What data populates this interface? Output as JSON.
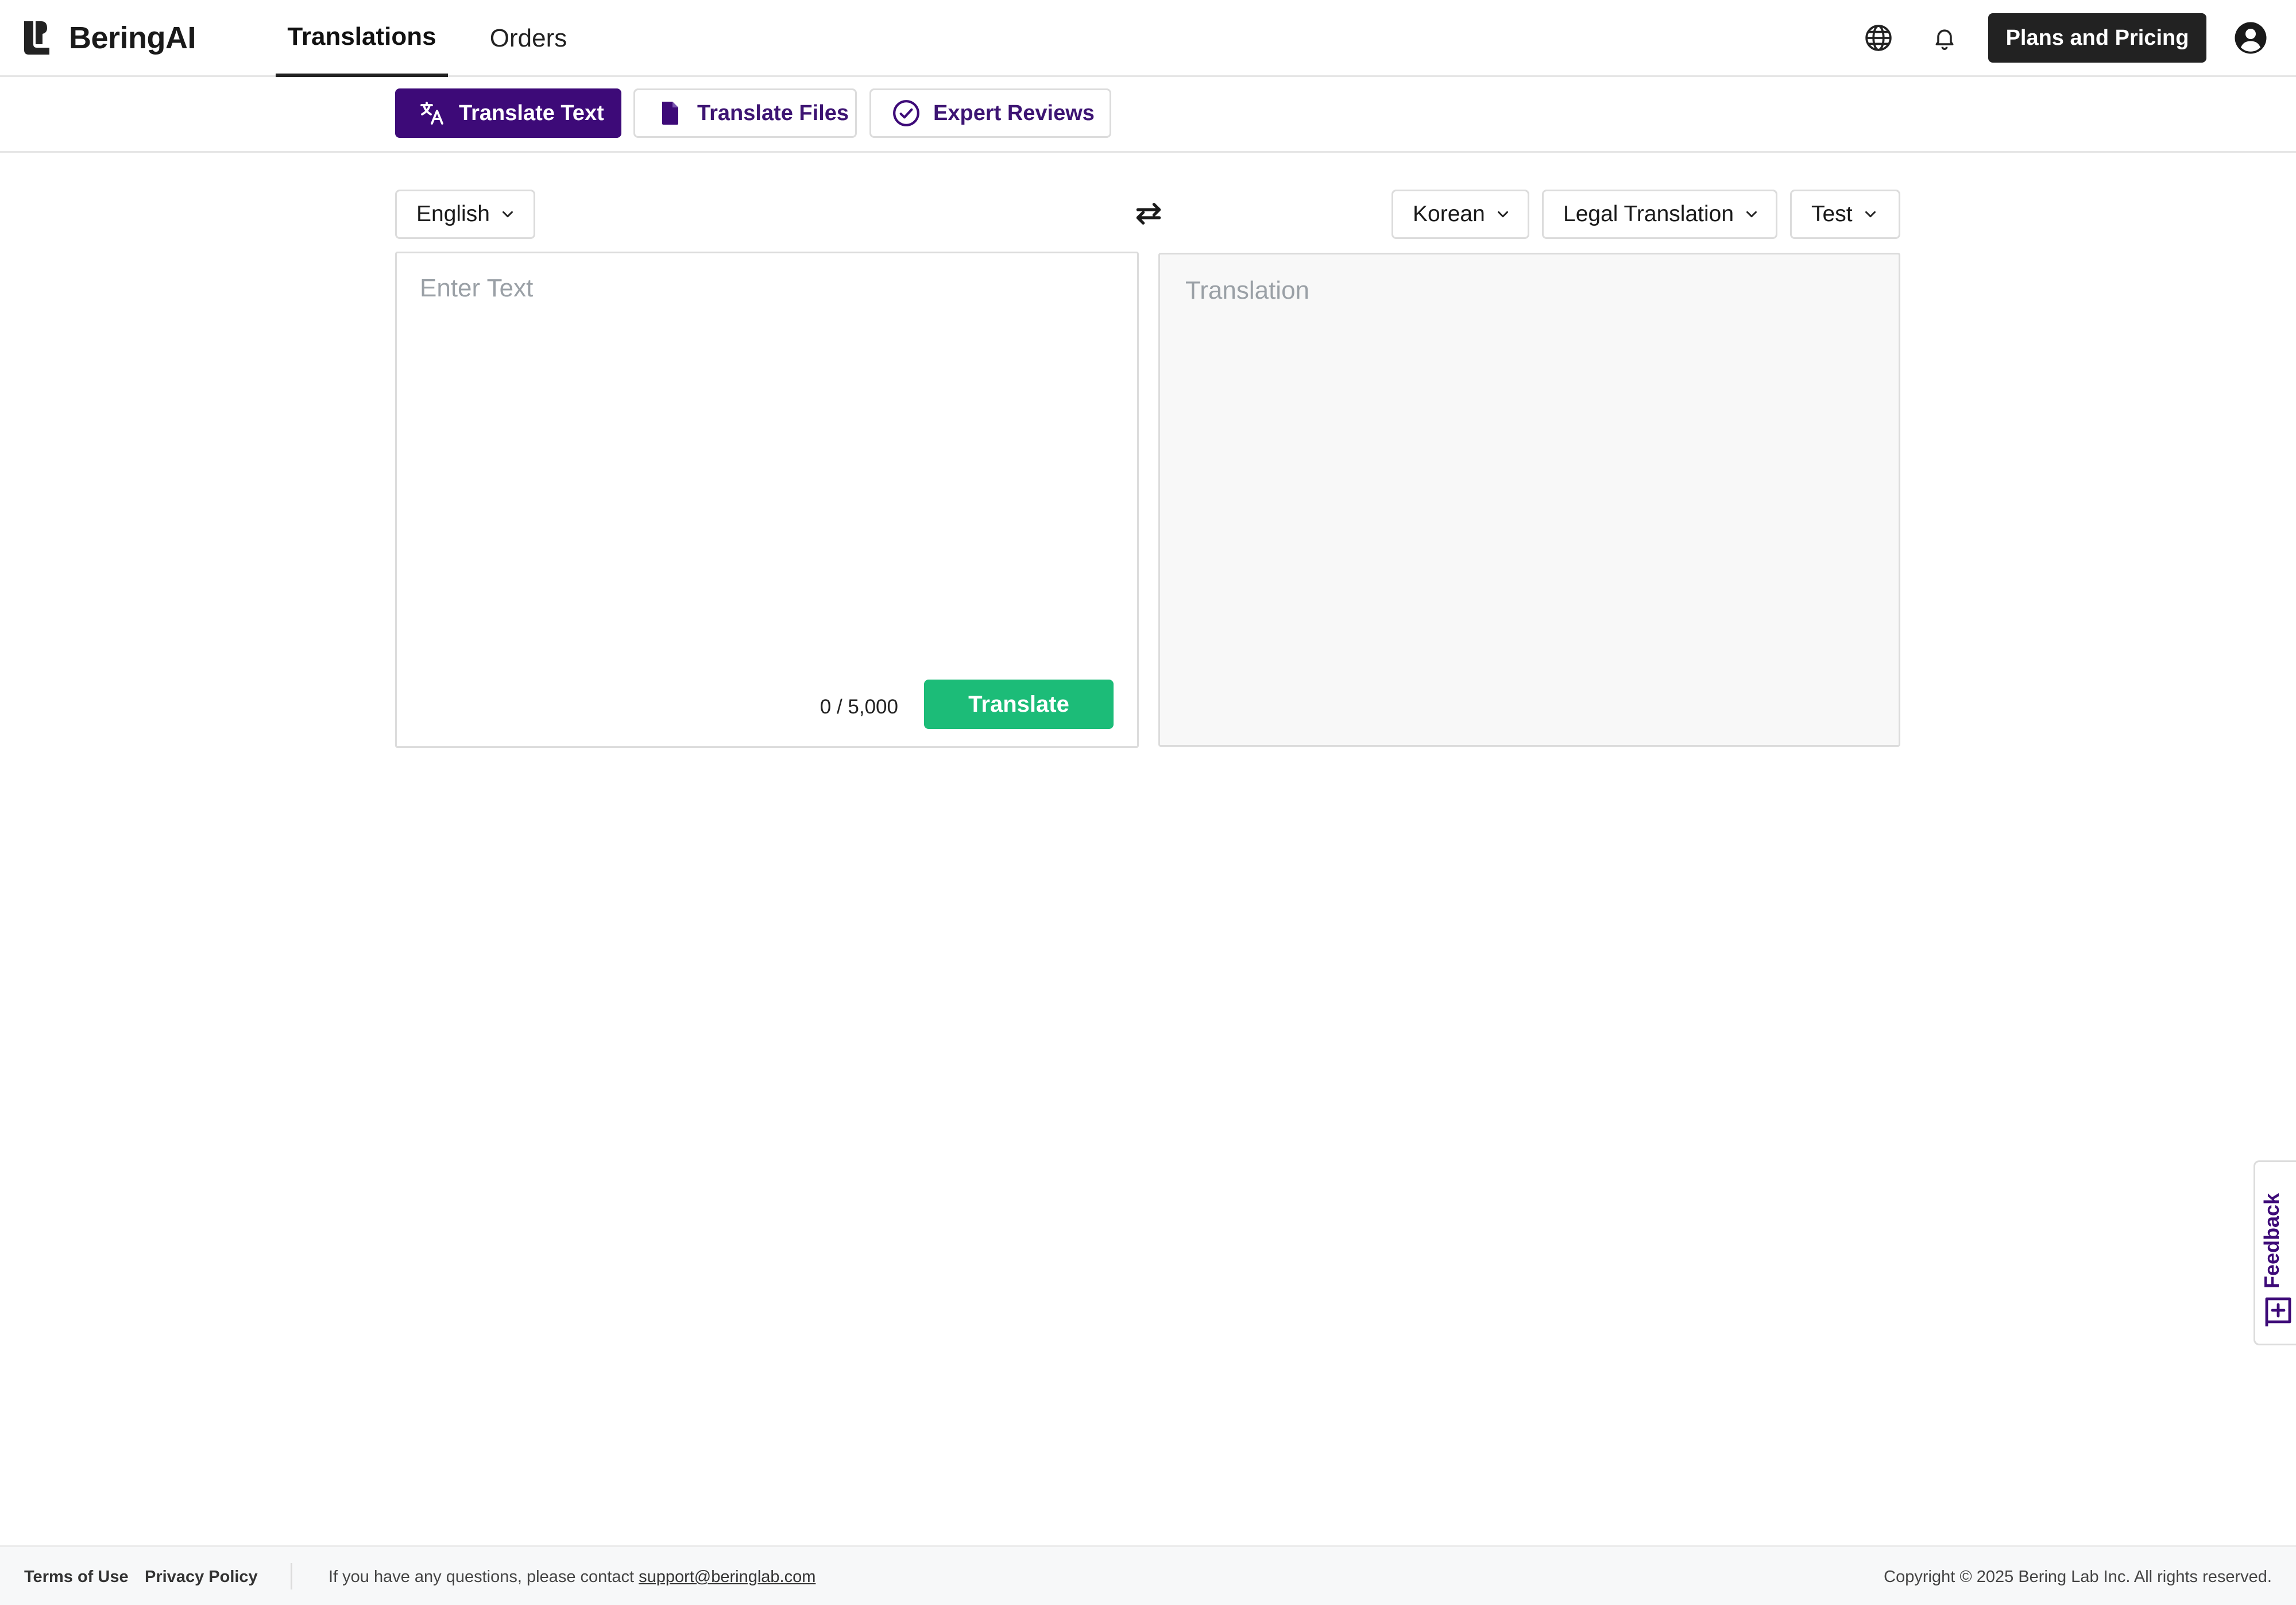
{
  "app": {
    "brand": "BeringAI",
    "nav": {
      "translations": "Translations",
      "orders": "Orders"
    },
    "header_actions": {
      "plans_label": "Plans and Pricing"
    }
  },
  "subtabs": {
    "translate_text": "Translate Text",
    "translate_files": "Translate Files",
    "expert_reviews": "Expert Reviews"
  },
  "controls": {
    "source_language": "English",
    "target_language": "Korean",
    "domain": "Legal Translation",
    "profile": "Test"
  },
  "source": {
    "placeholder": "Enter Text",
    "value": "",
    "char_count": "0 / 5,000",
    "translate_label": "Translate"
  },
  "target": {
    "placeholder": "Translation"
  },
  "feedback": {
    "label": "Feedback"
  },
  "footer": {
    "terms": "Terms of Use",
    "privacy": "Privacy Policy",
    "contact_prefix": "If you have any questions, please contact ",
    "contact_email": "support@beringlab.com",
    "copyright": "Copyright © 2025 Bering Lab Inc. All rights reserved."
  },
  "icons": {
    "logo": "bering-logo-icon",
    "globe": "globe-icon",
    "bell": "bell-icon",
    "user": "user-circle-icon",
    "translate": "translate-icon",
    "file": "file-icon",
    "check": "check-circle-icon",
    "chevron": "chevron-down-icon",
    "swap": "swap-icon",
    "feedback": "feedback-plus-icon"
  },
  "colors": {
    "brand_purple": "#3d0a78",
    "translate_green": "#1cbc78",
    "header_dark": "#222222"
  }
}
